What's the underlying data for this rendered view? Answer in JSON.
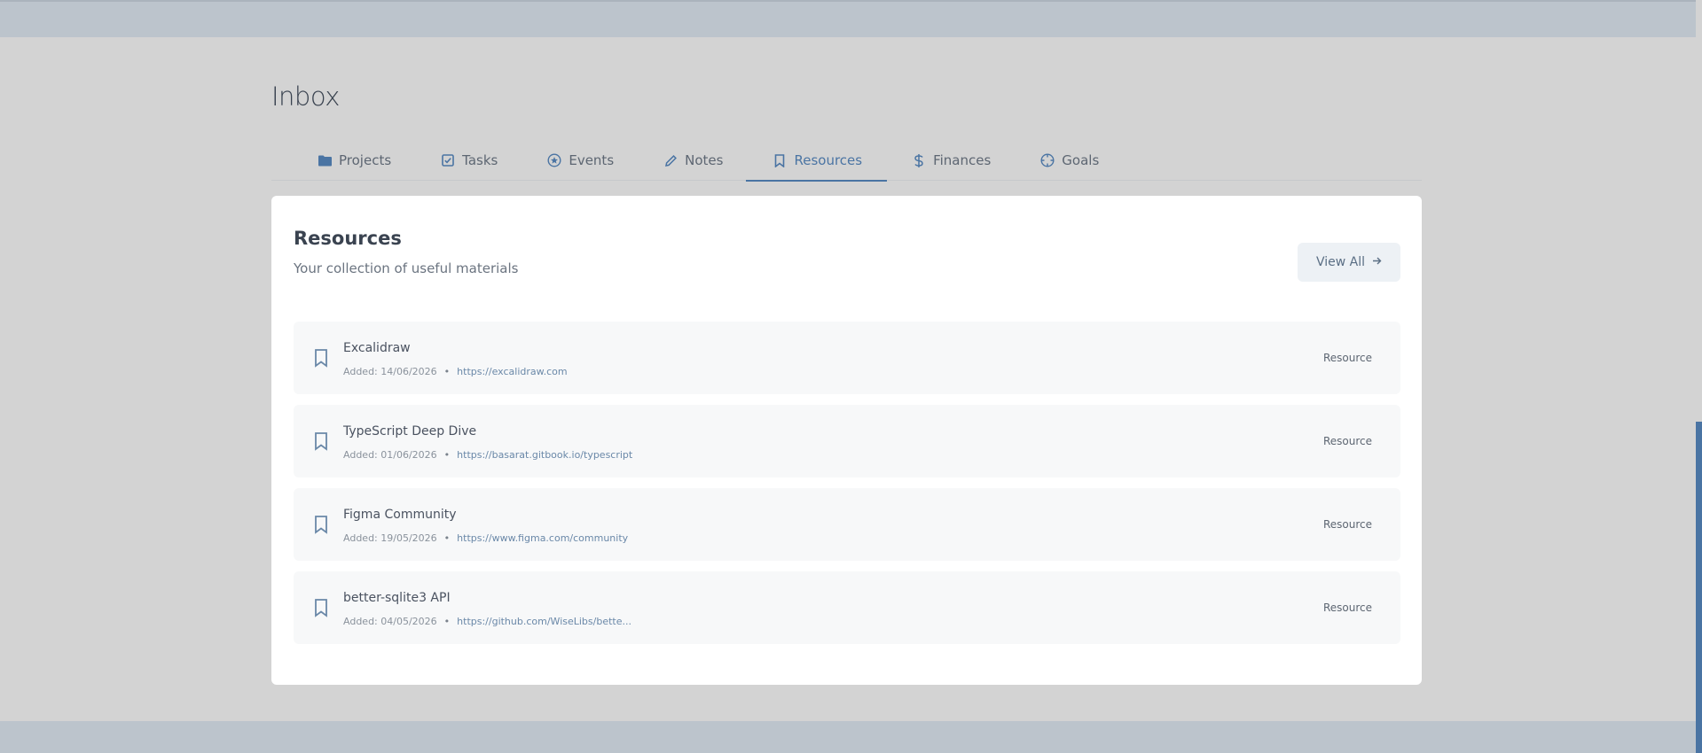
{
  "header": {
    "title": "Inbox"
  },
  "tabs": [
    {
      "label": "Projects",
      "icon": "folder-icon"
    },
    {
      "label": "Tasks",
      "icon": "checkbox-icon"
    },
    {
      "label": "Events",
      "icon": "star-circle-icon"
    },
    {
      "label": "Notes",
      "icon": "pencil-icon"
    },
    {
      "label": "Resources",
      "icon": "bookmark-icon",
      "active": true
    },
    {
      "label": "Finances",
      "icon": "dollar-icon"
    },
    {
      "label": "Goals",
      "icon": "target-icon"
    }
  ],
  "panel": {
    "title": "Resources",
    "subtitle": "Your collection of useful materials",
    "view_all_label": "View All"
  },
  "resources": [
    {
      "name": "Excalidraw",
      "added": "Added: 14/06/2026",
      "url": "https://excalidraw.com",
      "tag": "Resource"
    },
    {
      "name": "TypeScript Deep Dive",
      "added": "Added: 01/06/2026",
      "url": "https://basarat.gitbook.io/typescript",
      "tag": "Resource"
    },
    {
      "name": "Figma Community",
      "added": "Added: 19/05/2026",
      "url": "https://www.figma.com/community",
      "tag": "Resource"
    },
    {
      "name": "better-sqlite3 API",
      "added": "Added: 04/05/2026",
      "url": "https://github.com/WiseLibs/bette...",
      "tag": "Resource"
    }
  ],
  "colors": {
    "accent": "#4a74a3",
    "background": "#d3d3d3",
    "panel": "#ffffff"
  }
}
